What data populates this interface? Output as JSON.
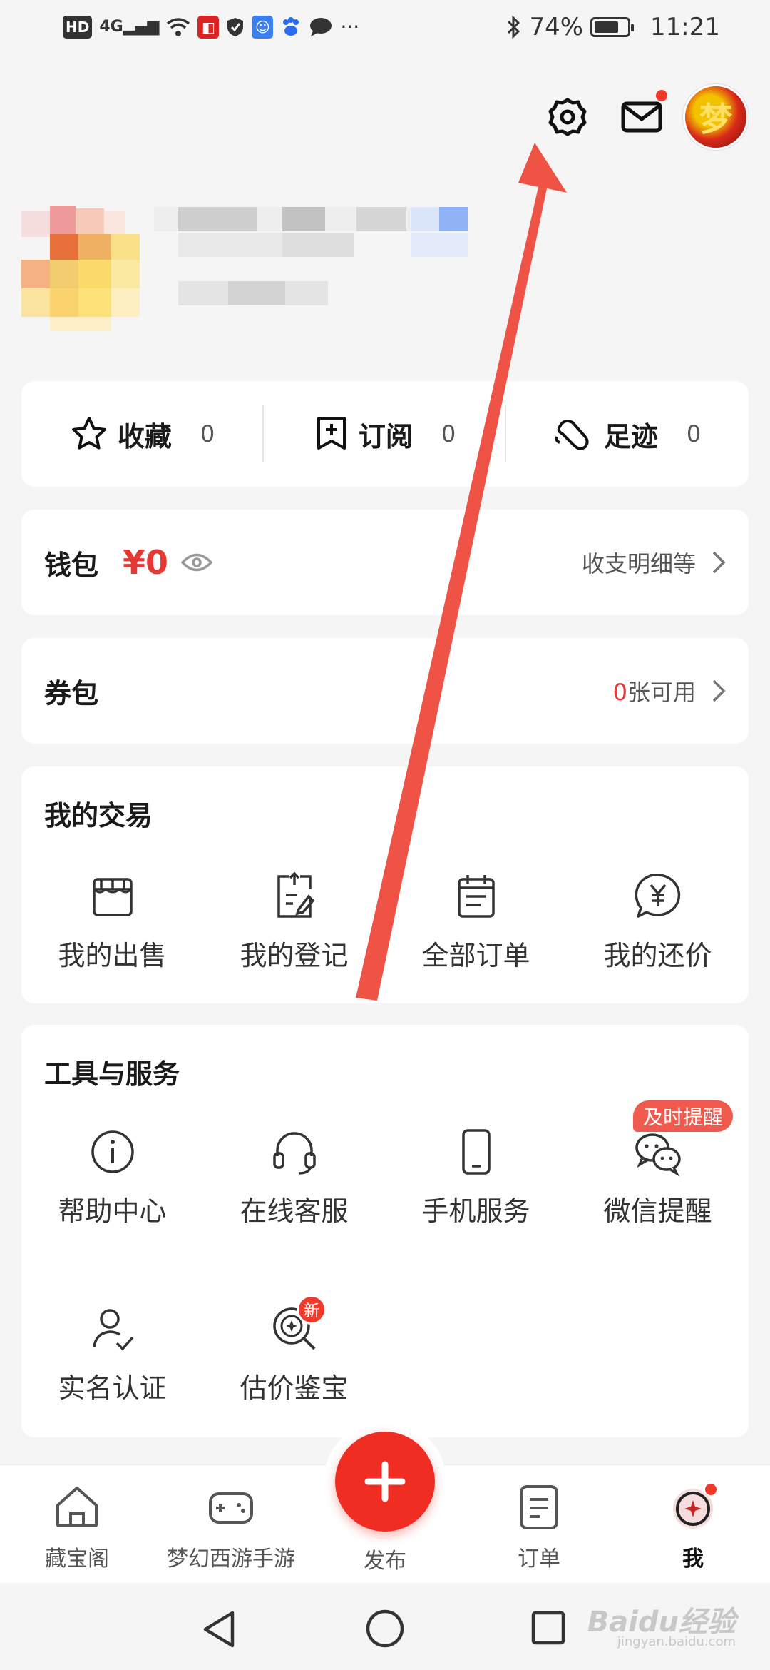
{
  "status_bar": {
    "hd": "HD",
    "network": "4G",
    "battery": "74%",
    "battery_level": 0.74,
    "time": "11:21",
    "more": "···"
  },
  "profile": {
    "avatar_text": "梦"
  },
  "stats": [
    {
      "label": "收藏",
      "count": "0",
      "icon": "star-icon"
    },
    {
      "label": "订阅",
      "count": "0",
      "icon": "bookmark-plus-icon"
    },
    {
      "label": "足迹",
      "count": "0",
      "icon": "footprint-icon"
    }
  ],
  "wallet": {
    "title": "钱包",
    "amount": "¥0",
    "detail": "收支明细等"
  },
  "coupons": {
    "title": "券包",
    "count": "0",
    "suffix": "张可用"
  },
  "trading": {
    "title": "我的交易",
    "items": [
      {
        "label": "我的出售",
        "icon": "shop-icon"
      },
      {
        "label": "我的登记",
        "icon": "register-doc-icon"
      },
      {
        "label": "全部订单",
        "icon": "calendar-list-icon"
      },
      {
        "label": "我的还价",
        "icon": "yen-bubble-icon"
      }
    ]
  },
  "services": {
    "title": "工具与服务",
    "remind_tag": "及时提醒",
    "new_tag": "新",
    "items": [
      {
        "label": "帮助中心",
        "icon": "info-icon"
      },
      {
        "label": "在线客服",
        "icon": "headset-icon"
      },
      {
        "label": "手机服务",
        "icon": "phone-icon"
      },
      {
        "label": "微信提醒",
        "icon": "wechat-icon"
      },
      {
        "label": "实名认证",
        "icon": "user-check-icon"
      },
      {
        "label": "估价鉴宝",
        "icon": "appraise-icon"
      }
    ]
  },
  "bottom_nav": {
    "items": [
      {
        "label": "藏宝阁",
        "icon": "house-icon"
      },
      {
        "label": "梦幻西游手游",
        "icon": "gamepad-icon"
      },
      {
        "label": "订单",
        "icon": "order-doc-icon"
      },
      {
        "label": "我",
        "icon": "me-icon"
      }
    ],
    "publish_label": "发布"
  },
  "watermark": {
    "brand": "Baidu经验",
    "url": "jingyan.baidu.com"
  },
  "colors": {
    "accent": "#e53935",
    "publish": "#ef2d23",
    "arrow": "#ee4a3c",
    "background": "#f5f5f5"
  }
}
